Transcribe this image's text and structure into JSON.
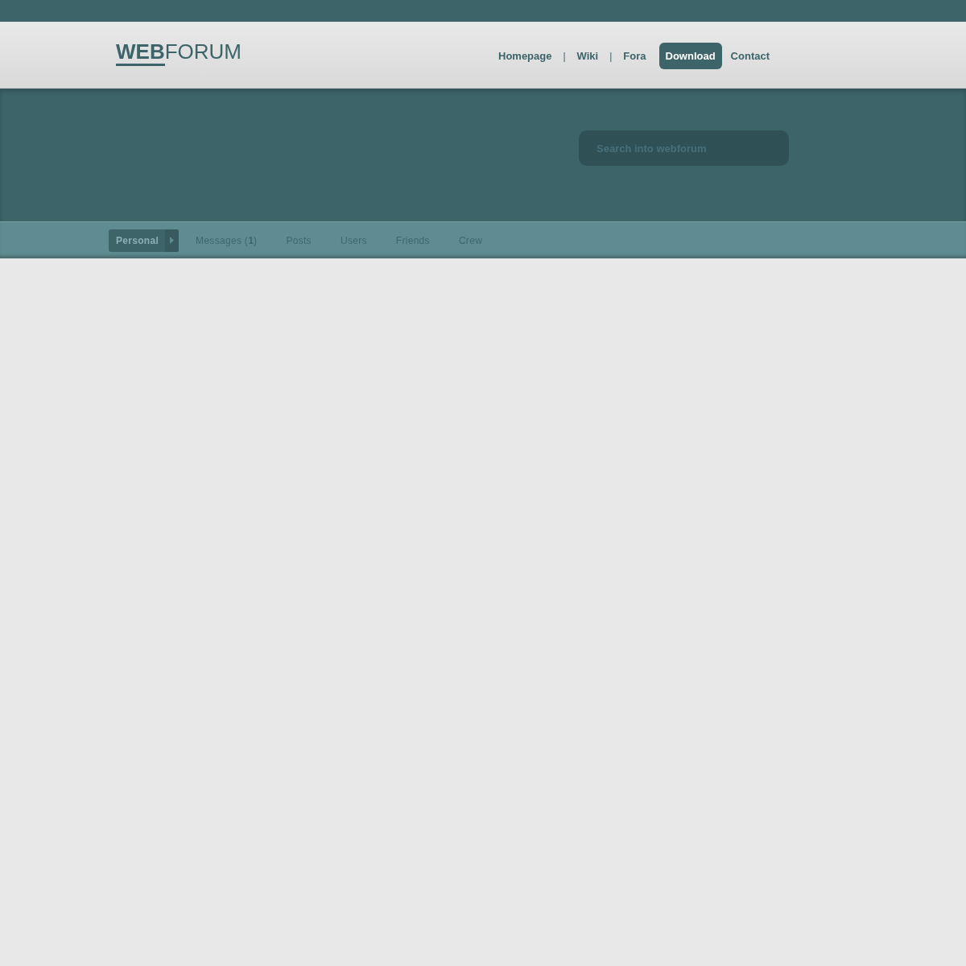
{
  "logo": {
    "bold_part": "WEB",
    "rest": "FORUM"
  },
  "nav": [
    {
      "kind": "link",
      "label": "Homepage",
      "selected": false
    },
    {
      "kind": "separator",
      "label": "|"
    },
    {
      "kind": "link",
      "label": "Wiki",
      "selected": false
    },
    {
      "kind": "separator",
      "label": "|"
    },
    {
      "kind": "link",
      "label": "Fora",
      "selected": false
    },
    {
      "kind": "link",
      "label": "Download",
      "selected": true
    },
    {
      "kind": "link",
      "label": "Contact",
      "selected": false
    }
  ],
  "search": {
    "placeholder": "Search into webforum"
  },
  "tabs": [
    {
      "label": "Personal",
      "selected": true
    },
    {
      "label": "Messages (**1**)",
      "selected": false
    },
    {
      "label": "Posts",
      "selected": false
    },
    {
      "label": "Users",
      "selected": false
    },
    {
      "label": "Friends",
      "selected": false
    },
    {
      "label": "Crew",
      "selected": false
    }
  ]
}
